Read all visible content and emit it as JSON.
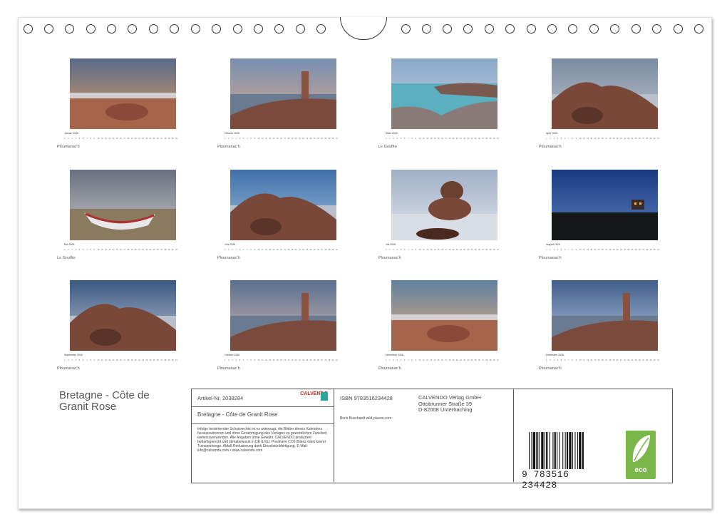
{
  "months": [
    {
      "name": "Januar 2026",
      "location": "Ploumanac'h",
      "scene": "beach-sunset"
    },
    {
      "name": "Februar 2026",
      "location": "Ploumanac'h",
      "scene": "lighthouse-dusk"
    },
    {
      "name": "März 2026",
      "location": "Le Gouffre",
      "scene": "turquoise-cove"
    },
    {
      "name": "April 2026",
      "location": "Ploumanac'h",
      "scene": "stacked-rocks"
    },
    {
      "name": "Mai 2026",
      "location": "Le Gouffre",
      "scene": "boat"
    },
    {
      "name": "Juni 2026",
      "location": "Ploumanac'h",
      "scene": "rocks-blue"
    },
    {
      "name": "Juli 2026",
      "location": "Ploumanac'h",
      "scene": "rock-tower"
    },
    {
      "name": "August 2026",
      "location": "Ploumanac'h",
      "scene": "night-house"
    },
    {
      "name": "September 2026",
      "location": "Ploumanac'h",
      "scene": "waves-rocks"
    },
    {
      "name": "Oktober 2026",
      "location": "Ploumanac'h",
      "scene": "lighthouse-rocks"
    },
    {
      "name": "November 2026",
      "location": "Ploumanac'h",
      "scene": "beach-rocks"
    },
    {
      "name": "Dezember 2026",
      "location": "Ploumanac'h",
      "scene": "lighthouse-blue"
    }
  ],
  "title": "Bretagne - Côte de Granit Rose",
  "article": "Artikel-Nr. 2038284",
  "logo": "CALVENDO",
  "product_title": "Bretagne - Côte de Granit Rose",
  "legal": "Infolge bestehender Schutzrechte ist es untersagt, die Blätter dieses Kalenders herauszutrennen und ohne Genehmigung des Verlages zu gewerblichen Zwecken weiterzuverwenden. Alle Angaben ohne Gewähr. CALVENDO produziert bedarfsgerecht und klimabewusst in DE & EU. Positivere CO2-Bilanz dank kurzer Transportwege. Abfall-Reduzierung dank Einzelstückfertigung. E-Mail: info@calvendo.com • www.calvendo.com",
  "isbn": "ISBN 9783516234428",
  "author": "Boris Buschardt wild-places.com",
  "publisher": [
    "CALVENDO Verlag GmbH",
    "Ottobrunner Straße 39",
    "D-82008 Unterhaching"
  ],
  "barcode_text": "9 783516 234428",
  "eco_label": "eco"
}
